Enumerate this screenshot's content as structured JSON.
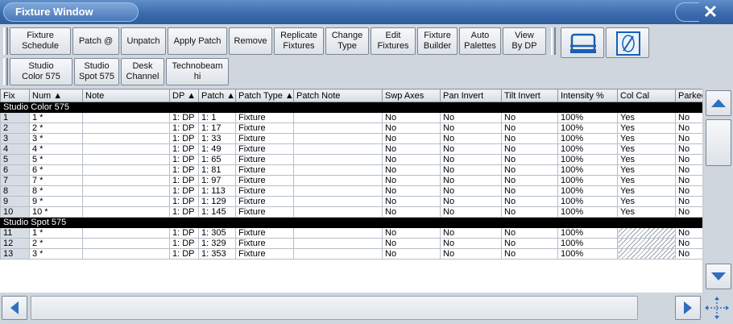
{
  "window": {
    "title": "Fixture Window",
    "close_symbol": "✕"
  },
  "toolbar": {
    "row1": [
      {
        "name": "fixture-schedule-button",
        "label": "Fixture\nSchedule"
      },
      {
        "name": "patch-at-button",
        "label": "Patch @"
      },
      {
        "name": "unpatch-button",
        "label": "Unpatch"
      },
      {
        "name": "apply-patch-button",
        "label": "Apply Patch"
      },
      {
        "name": "remove-button",
        "label": "Remove"
      },
      {
        "name": "replicate-fixtures-button",
        "label": "Replicate\nFixtures"
      },
      {
        "name": "change-type-button",
        "label": "Change\nType"
      },
      {
        "name": "edit-fixtures-button",
        "label": "Edit\nFixtures"
      },
      {
        "name": "fixture-builder-button",
        "label": "Fixture\nBuilder"
      },
      {
        "name": "auto-palettes-button",
        "label": "Auto\nPalettes"
      },
      {
        "name": "view-by-dp-button",
        "label": "View\nBy DP"
      }
    ],
    "row2": [
      {
        "name": "studio-color-575-button",
        "label": "Studio\nColor 575"
      },
      {
        "name": "studio-spot-575-button",
        "label": "Studio\nSpot 575"
      },
      {
        "name": "desk-channel-button",
        "label": "Desk\nChannel"
      },
      {
        "name": "technobeam-hi-button",
        "label": "Technobeam\nhi"
      }
    ],
    "icons": [
      "print-icon",
      "page-view-icon"
    ]
  },
  "table": {
    "columns": [
      "Fix",
      "Num ▲",
      "Note",
      "DP ▲",
      "Patch ▲",
      "Patch Type ▲",
      "Patch Note",
      "Swp Axes",
      "Pan Invert",
      "Tilt Invert",
      "Intensity %",
      "Col Cal",
      "Parked"
    ],
    "groups": [
      {
        "label": "Studio Color 575",
        "rows": [
          [
            "1",
            "1 *",
            "",
            "1: DP",
            "1: 1",
            "Fixture",
            "",
            "No",
            "No",
            "No",
            "100%",
            "Yes",
            "No"
          ],
          [
            "2",
            "2 *",
            "",
            "1: DP",
            "1: 17",
            "Fixture",
            "",
            "No",
            "No",
            "No",
            "100%",
            "Yes",
            "No"
          ],
          [
            "3",
            "3 *",
            "",
            "1: DP",
            "1: 33",
            "Fixture",
            "",
            "No",
            "No",
            "No",
            "100%",
            "Yes",
            "No"
          ],
          [
            "4",
            "4 *",
            "",
            "1: DP",
            "1: 49",
            "Fixture",
            "",
            "No",
            "No",
            "No",
            "100%",
            "Yes",
            "No"
          ],
          [
            "5",
            "5 *",
            "",
            "1: DP",
            "1: 65",
            "Fixture",
            "",
            "No",
            "No",
            "No",
            "100%",
            "Yes",
            "No"
          ],
          [
            "6",
            "6 *",
            "",
            "1: DP",
            "1: 81",
            "Fixture",
            "",
            "No",
            "No",
            "No",
            "100%",
            "Yes",
            "No"
          ],
          [
            "7",
            "7 *",
            "",
            "1: DP",
            "1: 97",
            "Fixture",
            "",
            "No",
            "No",
            "No",
            "100%",
            "Yes",
            "No"
          ],
          [
            "8",
            "8 *",
            "",
            "1: DP",
            "1: 113",
            "Fixture",
            "",
            "No",
            "No",
            "No",
            "100%",
            "Yes",
            "No"
          ],
          [
            "9",
            "9 *",
            "",
            "1: DP",
            "1: 129",
            "Fixture",
            "",
            "No",
            "No",
            "No",
            "100%",
            "Yes",
            "No"
          ],
          [
            "10",
            "10 *",
            "",
            "1: DP",
            "1: 145",
            "Fixture",
            "",
            "No",
            "No",
            "No",
            "100%",
            "Yes",
            "No"
          ]
        ]
      },
      {
        "label": "Studio Spot 575",
        "rows": [
          [
            "11",
            "1 *",
            "",
            "1: DP",
            "1: 305",
            "Fixture",
            "",
            "No",
            "No",
            "No",
            "100%",
            "",
            "No"
          ],
          [
            "12",
            "2 *",
            "",
            "1: DP",
            "1: 329",
            "Fixture",
            "",
            "No",
            "No",
            "No",
            "100%",
            "",
            "No"
          ],
          [
            "13",
            "3 *",
            "",
            "1: DP",
            "1: 353",
            "Fixture",
            "",
            "No",
            "No",
            "No",
            "100%",
            "",
            "No"
          ]
        ]
      }
    ]
  },
  "colors": {
    "title_bar": "#3b6bad",
    "header_row": "#000000",
    "scroll_arrow": "#2f6fc0"
  }
}
